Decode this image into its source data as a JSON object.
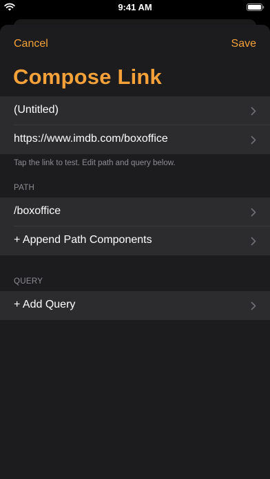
{
  "status_bar": {
    "time": "9:41 AM",
    "wifi_icon": "wifi-icon",
    "battery_icon": "battery-icon"
  },
  "nav": {
    "cancel_label": "Cancel",
    "save_label": "Save"
  },
  "page": {
    "title": "Compose Link"
  },
  "link_section": {
    "rows": [
      {
        "label": "(Untitled)"
      },
      {
        "label": "https://www.imdb.com/boxoffice"
      }
    ],
    "footer": "Tap the link to test. Edit path and query below."
  },
  "path_section": {
    "header": "PATH",
    "rows": [
      {
        "label": "/boxoffice"
      },
      {
        "label": "+ Append Path Components"
      }
    ]
  },
  "query_section": {
    "header": "QUERY",
    "rows": [
      {
        "label": "+ Add Query"
      }
    ]
  },
  "colors": {
    "accent": "#f5a13a",
    "background": "#1c1c1e",
    "cell": "#2c2c2e",
    "secondary_text": "#8e8e93",
    "chevron": "#6e6e73"
  },
  "icons": {
    "row_accessory": "chevron-right-icon"
  }
}
